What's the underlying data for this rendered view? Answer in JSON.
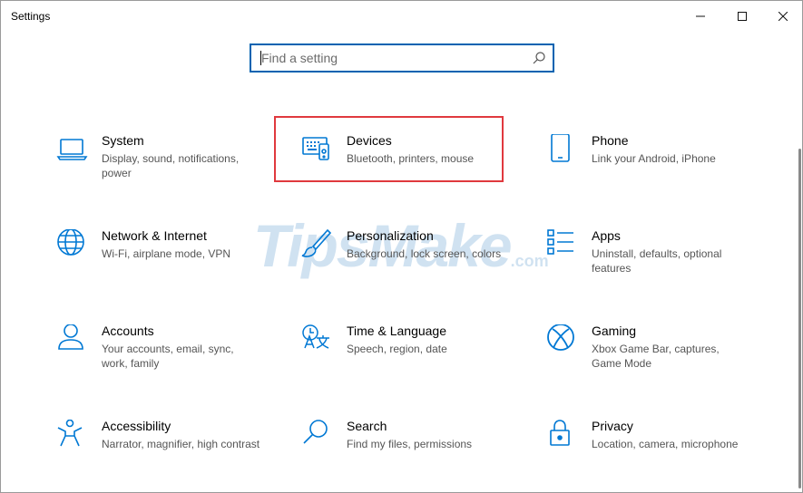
{
  "window": {
    "title": "Settings"
  },
  "controls": {
    "minimize": "minimize",
    "maximize": "maximize",
    "close": "close"
  },
  "search": {
    "placeholder": "Find a setting",
    "value": ""
  },
  "colors": {
    "accent": "#0078d4",
    "highlight_border": "#e0393e",
    "search_border": "#0063b1"
  },
  "watermark": {
    "text": "TipsMake",
    "suffix": ".com"
  },
  "tiles": [
    {
      "name": "System",
      "desc": "Display, sound, notifications, power",
      "icon": "laptop-icon"
    },
    {
      "name": "Devices",
      "desc": "Bluetooth, printers, mouse",
      "icon": "devices-icon"
    },
    {
      "name": "Phone",
      "desc": "Link your Android, iPhone",
      "icon": "phone-icon"
    },
    {
      "name": "Network & Internet",
      "desc": "Wi-Fi, airplane mode, VPN",
      "icon": "globe-icon"
    },
    {
      "name": "Personalization",
      "desc": "Background, lock screen, colors",
      "icon": "brush-icon"
    },
    {
      "name": "Apps",
      "desc": "Uninstall, defaults, optional features",
      "icon": "apps-list-icon"
    },
    {
      "name": "Accounts",
      "desc": "Your accounts, email, sync, work, family",
      "icon": "person-icon"
    },
    {
      "name": "Time & Language",
      "desc": "Speech, region, date",
      "icon": "time-language-icon"
    },
    {
      "name": "Gaming",
      "desc": "Xbox Game Bar, captures, Game Mode",
      "icon": "xbox-icon"
    },
    {
      "name": "Accessibility",
      "desc": "Narrator, magnifier, high contrast",
      "icon": "accessibility-icon"
    },
    {
      "name": "Search",
      "desc": "Find my files, permissions",
      "icon": "search-icon"
    },
    {
      "name": "Privacy",
      "desc": "Location, camera, microphone",
      "icon": "lock-icon"
    }
  ]
}
